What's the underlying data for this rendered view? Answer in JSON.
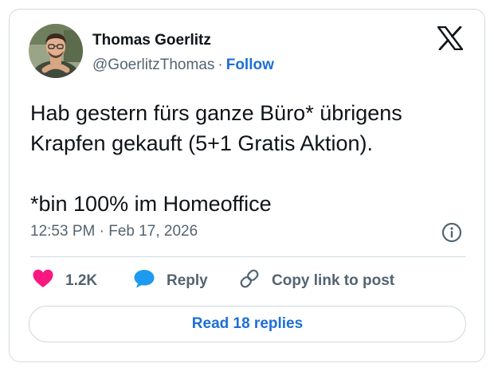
{
  "author": {
    "name": "Thomas Goerlitz",
    "handle": "@GoerlitzThomas",
    "separator": "·",
    "follow_label": "Follow"
  },
  "tweet": {
    "lines": [
      "Hab gestern fürs ganze Büro* übrigens",
      "Krapfen gekauft (5+1 Gratis Aktion).",
      "*bin 100% im Homeoffice"
    ],
    "timestamp": "12:53 PM · Feb 17, 2026"
  },
  "actions": {
    "like_count": "1.2K",
    "reply_label": "Reply",
    "copy_label": "Copy link to post"
  },
  "read_replies_label": "Read 18 replies",
  "icons": {
    "platform": "x-logo-icon",
    "info": "info-icon",
    "like": "heart-icon",
    "reply": "speech-bubble-icon",
    "copy": "link-icon"
  },
  "colors": {
    "text": "#0f1419",
    "secondary": "#536471",
    "accent": "#1d6fd6",
    "like": "#f91880",
    "reply": "#1d9bf0",
    "border": "#cfd9de"
  }
}
